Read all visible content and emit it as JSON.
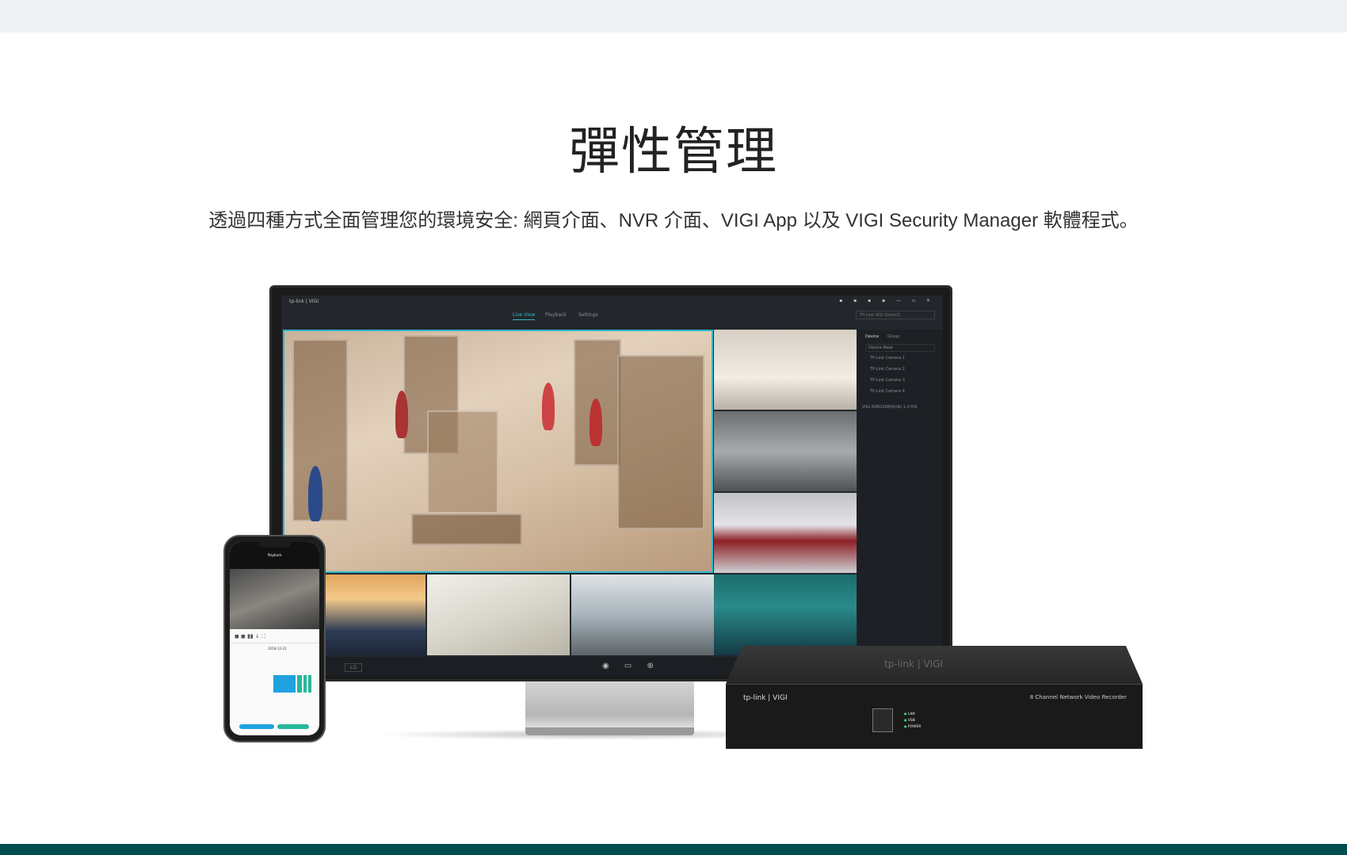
{
  "header": {
    "title": "彈性管理",
    "subtitle": "透過四種方式全面管理您的環境安全: 網頁介面、NVR 介面、VIGI App 以及 VIGI Security Manager 軟體程式。"
  },
  "monitor_app": {
    "brand": "tp-link | VIGI",
    "tabs": [
      "Live View",
      "Playback",
      "Settings"
    ],
    "device_selector": "TP-Link VIGI Zone(2)",
    "side_tabs": [
      "Device",
      "Group"
    ],
    "search_placeholder": "Device Base",
    "cameras": [
      "TP-Link Camera 1",
      "TP-Link Camera 2",
      "TP-Link Camera 3",
      "TP-Link Camera 4"
    ],
    "nvr_entry": "VIGI NVR1008H(UN) 1.0  0/9",
    "quality": "LQ"
  },
  "phone_app": {
    "header": "Playback",
    "date": "2018-12-22"
  },
  "nvr_device": {
    "brand": "tp-link | VIGI",
    "label": "8 Channel Network Video Recorder",
    "leds": [
      "LAN",
      "USB",
      "POWER"
    ]
  },
  "colors": {
    "accent": "#33b8cc",
    "footer": "#004d4f",
    "topbar": "#eef0f2"
  }
}
